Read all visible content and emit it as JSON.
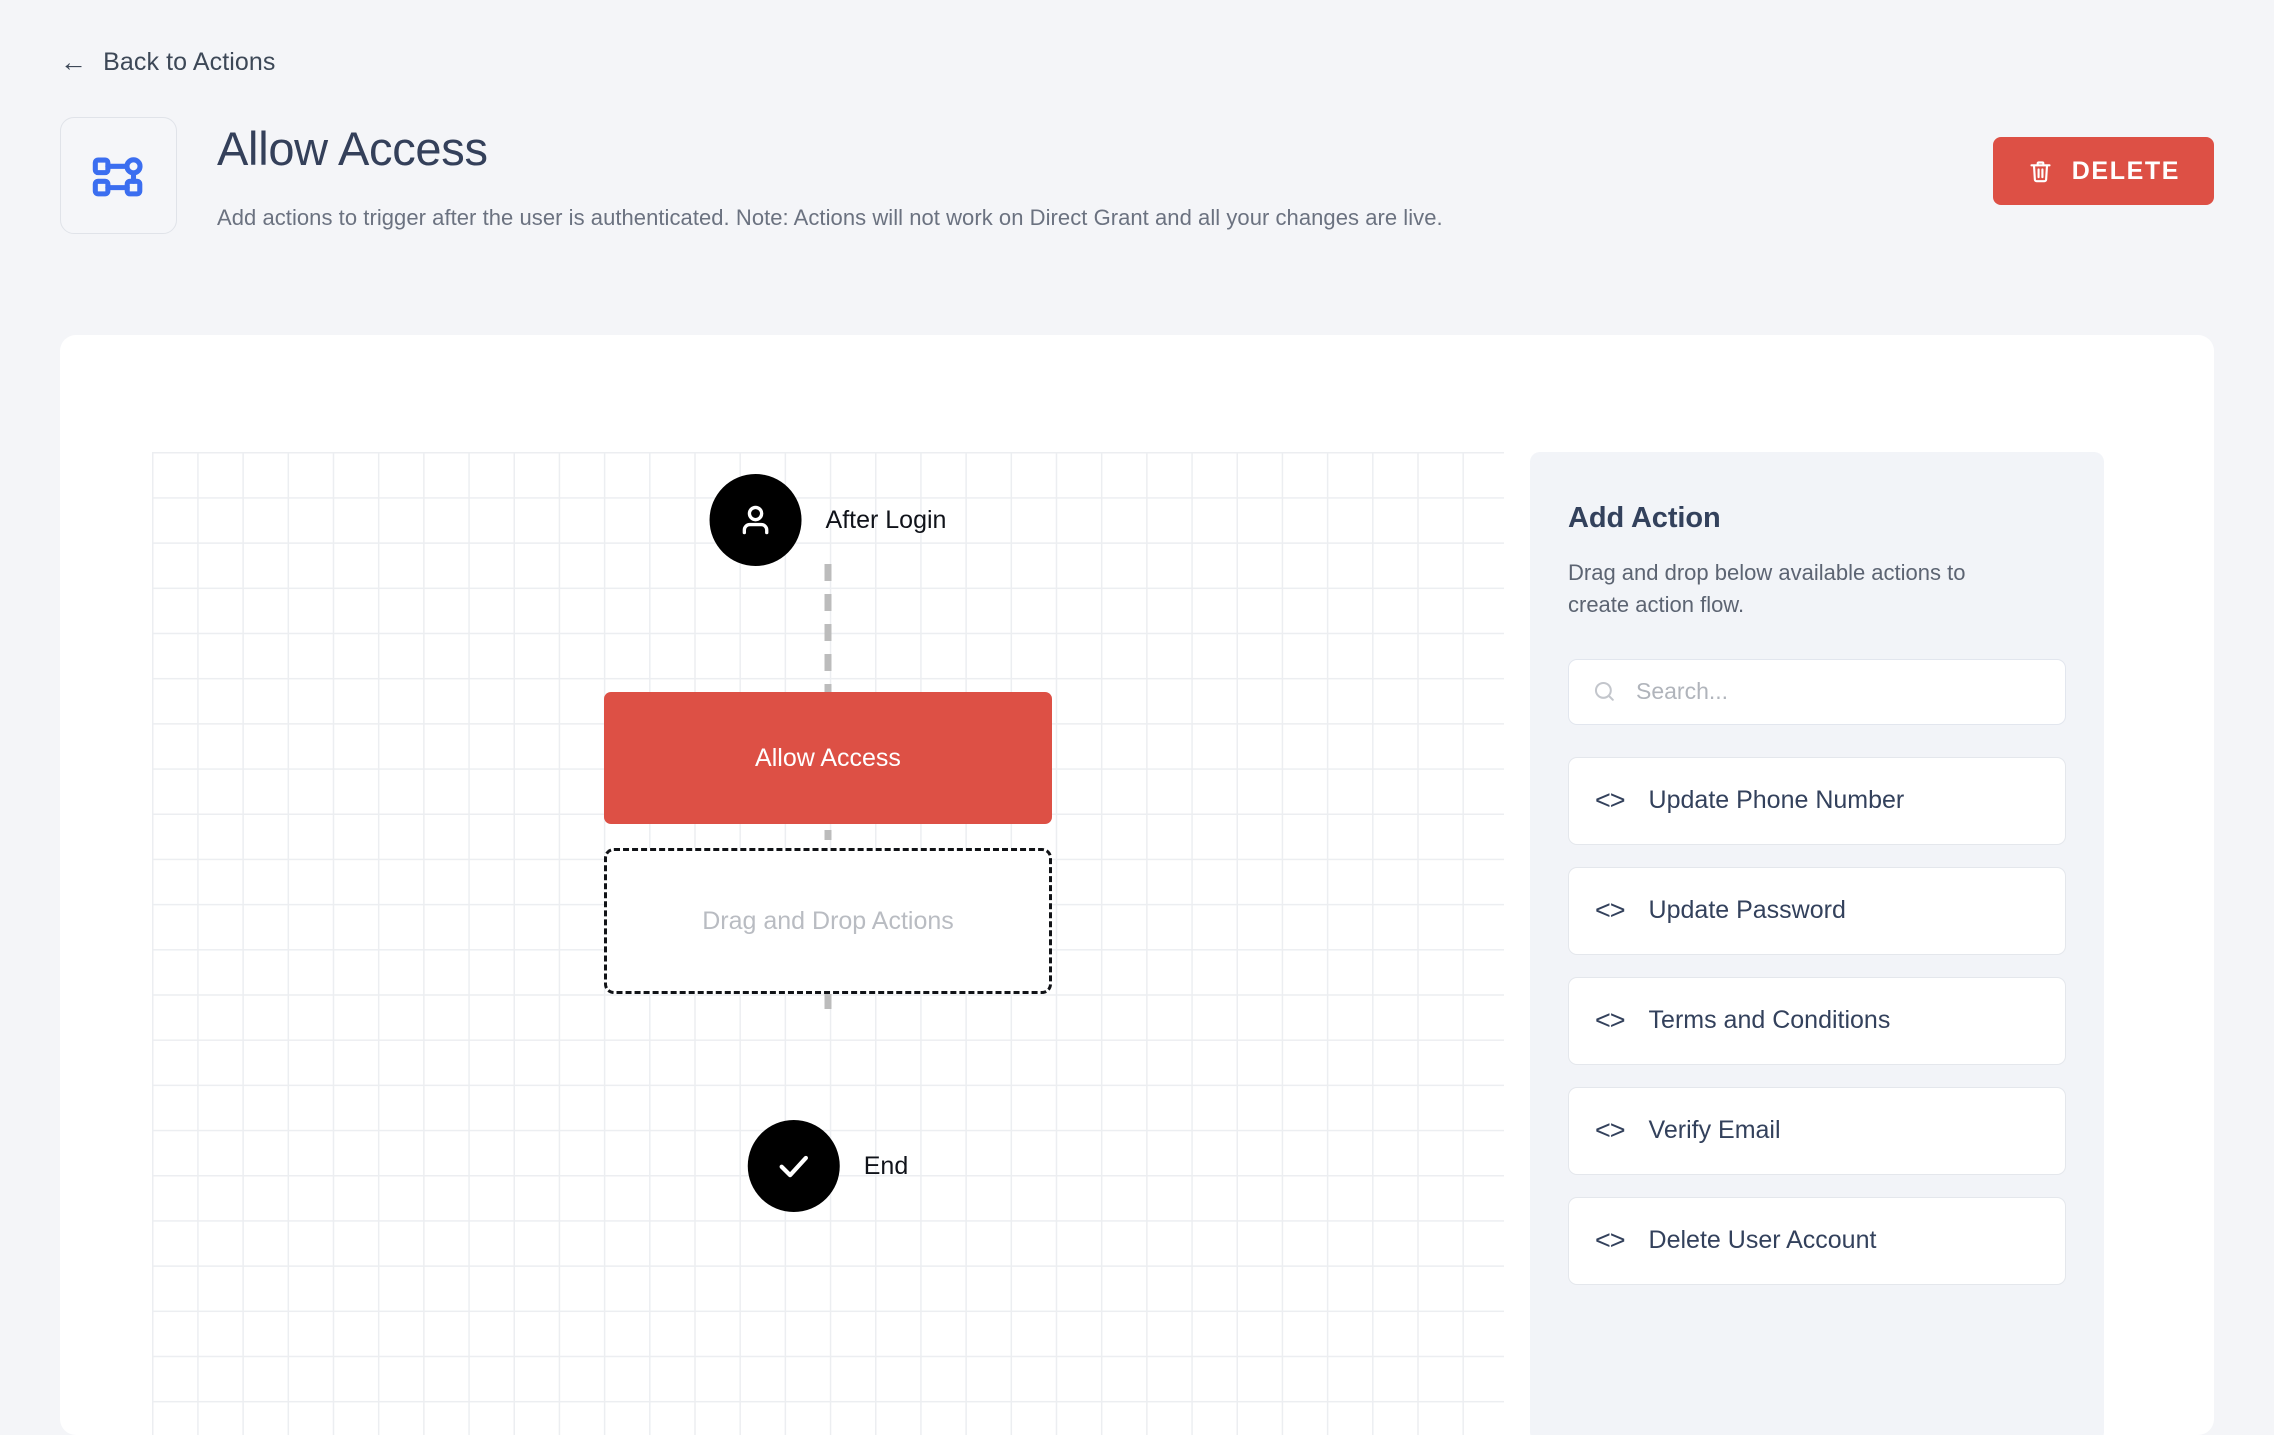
{
  "nav": {
    "back_label": "Back to Actions",
    "back_icon": "arrow-left-icon"
  },
  "header": {
    "icon": "flow-nodes-icon",
    "title": "Allow Access",
    "subtitle": "Add actions to trigger after the user is authenticated. Note: Actions will not work on Direct Grant and all your changes are live.",
    "delete_label": "DELETE",
    "delete_icon": "trash-icon",
    "delete_color": "#dd5045"
  },
  "flow": {
    "start_node": {
      "label": "After Login",
      "icon": "user-icon",
      "color": "#000000"
    },
    "action_node": {
      "label": "Allow Access",
      "color": "#dd5045"
    },
    "dropzone": {
      "label": "Drag and Drop Actions"
    },
    "end_node": {
      "label": "End",
      "icon": "check-icon",
      "color": "#000000"
    }
  },
  "panel": {
    "title": "Add Action",
    "description": "Drag and drop below available actions to create action flow.",
    "search": {
      "placeholder": "Search...",
      "value": "",
      "icon": "search-icon"
    },
    "actions": [
      {
        "icon": "code-icon",
        "label": "Update Phone Number"
      },
      {
        "icon": "code-icon",
        "label": "Update Password"
      },
      {
        "icon": "code-icon",
        "label": "Terms and Conditions"
      },
      {
        "icon": "code-icon",
        "label": "Verify Email"
      },
      {
        "icon": "code-icon",
        "label": "Delete User Account"
      }
    ]
  }
}
